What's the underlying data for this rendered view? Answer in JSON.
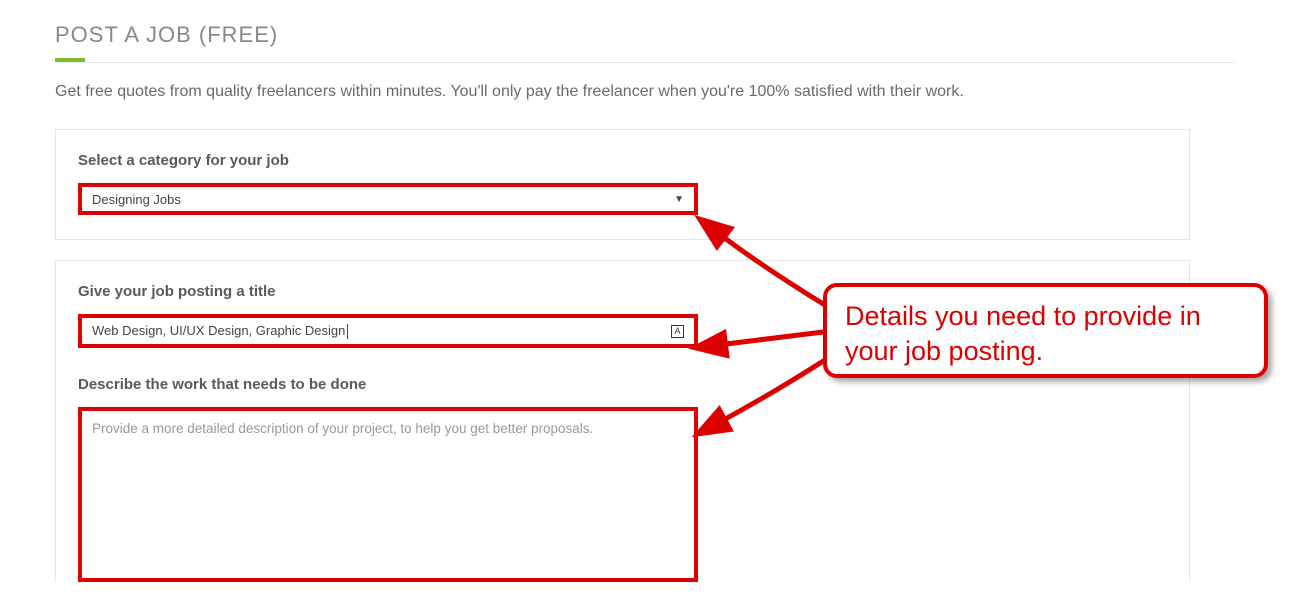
{
  "page": {
    "title": "POST A JOB (FREE)",
    "subtext": "Get free quotes from quality freelancers within minutes. You'll only pay the freelancer when you're 100% satisfied with their work."
  },
  "form": {
    "category": {
      "label": "Select a category for your job",
      "selected": "Designing Jobs"
    },
    "title_field": {
      "label": "Give your job posting a title",
      "value": "Web Design, UI/UX Design, Graphic Design"
    },
    "description": {
      "label": "Describe the work that needs to be done",
      "placeholder": "Provide a more detailed description of your project, to help you get better proposals."
    }
  },
  "annotation": {
    "callout_text": "Details you need to provide in your job posting."
  }
}
